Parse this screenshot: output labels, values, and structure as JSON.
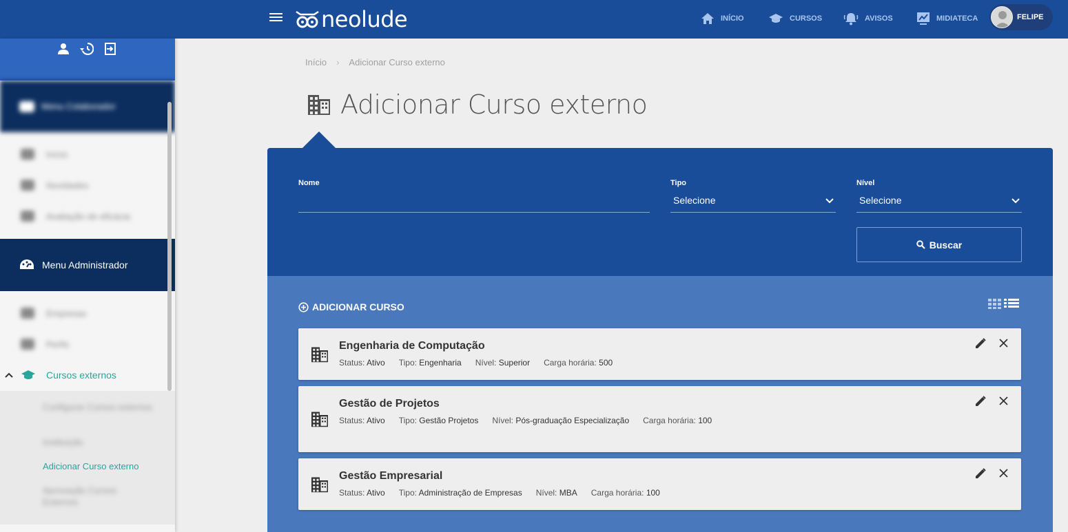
{
  "header": {
    "logo_text": "neolude",
    "nav": [
      {
        "label": "INÍCIO",
        "icon": "home-icon"
      },
      {
        "label": "CURSOS",
        "icon": "graduation-cap-icon"
      },
      {
        "label": "AVISOS",
        "icon": "bell-icon"
      },
      {
        "label": "MIDIATECA",
        "icon": "media-library-icon"
      }
    ],
    "user_name": "FELIPE"
  },
  "sidebar": {
    "sections": [
      {
        "label": "Menu Colaborador",
        "blurred": true
      },
      {
        "label": "Menu Administrador",
        "blurred": false
      }
    ],
    "collab_items": [
      "Início",
      "Novidades",
      "Avaliação de eficácia"
    ],
    "admin_items": [
      "Empresas",
      "Perfis"
    ],
    "active_group": "Cursos externos",
    "sub_items": [
      {
        "label": "Configurar Cursos externos",
        "active": false
      },
      {
        "label": "Instituição",
        "active": false
      },
      {
        "label": "Adicionar Curso externo",
        "active": true
      },
      {
        "label": "Aprovação Cursos Externos",
        "active": false
      }
    ]
  },
  "breadcrumb": {
    "home": "Início",
    "current": "Adicionar Curso externo"
  },
  "page_title": "Adicionar Curso externo",
  "filters": {
    "nome_label": "Nome",
    "nome_value": "",
    "tipo_label": "Tipo",
    "tipo_value": "Selecione",
    "nivel_label": "Nível",
    "nivel_value": "Selecione",
    "search_button": "Buscar"
  },
  "add_course_label": "ADICIONAR CURSO",
  "courses": [
    {
      "name": "Engenharia de Computação",
      "status_label": "Status:",
      "status": "Ativo",
      "tipo_label": "Tipo:",
      "tipo": "Engenharia",
      "nivel_label": "Nível:",
      "nivel": "Superior",
      "carga_label": "Carga horária:",
      "carga": "500"
    },
    {
      "name": "Gestão de Projetos",
      "status_label": "Status:",
      "status": "Ativo",
      "tipo_label": "Tipo:",
      "tipo": "Gestão Projetos",
      "nivel_label": "Nível:",
      "nivel": "Pós-graduação Especialização",
      "carga_label": "Carga horária:",
      "carga": "100"
    },
    {
      "name": "Gestão Empresarial",
      "status_label": "Status:",
      "status": "Ativo",
      "tipo_label": "Tipo:",
      "tipo": "Administração de Empresas",
      "nivel_label": "Nível:",
      "nivel": "MBA",
      "carga_label": "Carga horária:",
      "carga": "100"
    }
  ],
  "colors": {
    "primary": "#1a4d99",
    "panel": "#4a78bd",
    "sidebar_section": "#0c2e5e",
    "accent_green": "#26a69a"
  }
}
